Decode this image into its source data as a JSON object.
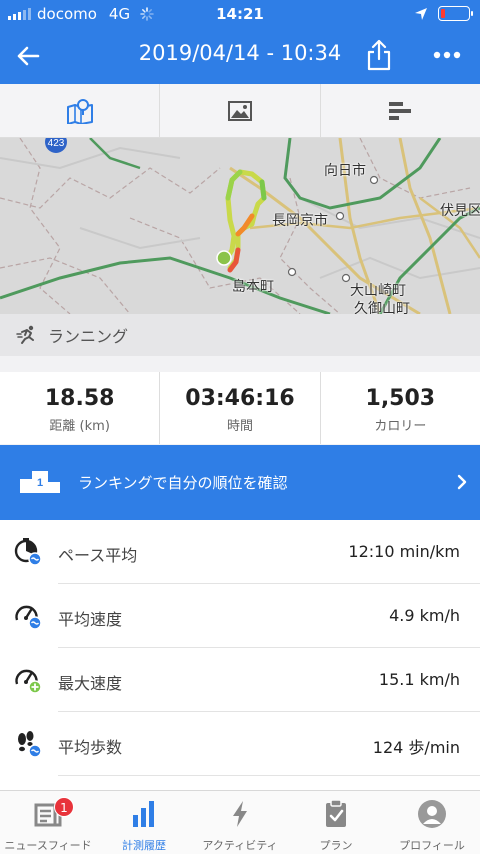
{
  "status_bar": {
    "carrier": "docomo",
    "network": "4G",
    "time": "14:21"
  },
  "header": {
    "title": "2019/04/14 - 10:34",
    "back_icon": "arrow-left-icon",
    "share_icon": "share-icon",
    "more_icon": "more-dots-icon"
  },
  "tabs": [
    {
      "icon": "map-icon",
      "active": true
    },
    {
      "icon": "image-icon",
      "active": false
    },
    {
      "icon": "bar-list-icon",
      "active": false
    }
  ],
  "map": {
    "labels": {
      "route_sign": "423",
      "mukou": "向日市",
      "nagaokakyo": "長岡京市",
      "fushimi": "伏見区",
      "shimamoto": "島本町",
      "oyamazaki": "大山崎町",
      "kuze": "久御山町"
    }
  },
  "activity": {
    "icon": "running-icon",
    "label": "ランニング"
  },
  "stats": [
    {
      "value": "18.58",
      "label": "距離 (km)"
    },
    {
      "value": "03:46:16",
      "label": "時間"
    },
    {
      "value": "1,503",
      "label": "カロリー"
    }
  ],
  "ranking": {
    "icon": "podium-icon",
    "label": "ランキングで自分の順位を確認",
    "podium_number": "1"
  },
  "details": [
    {
      "icon": "pace-icon",
      "label": "ペース平均",
      "value": "12:10 min/km"
    },
    {
      "icon": "speed-average-icon",
      "label": "平均速度",
      "value": "4.9 km/h"
    },
    {
      "icon": "speed-max-icon",
      "label": "最大速度",
      "value": "15.1 km/h"
    },
    {
      "icon": "footsteps-icon",
      "label": "平均歩数",
      "value": "124 歩/min"
    }
  ],
  "tabbar": [
    {
      "icon": "newsfeed-icon",
      "label": "ニュースフィード",
      "badge": "1",
      "active": false
    },
    {
      "icon": "history-bars-icon",
      "label": "計測履歴",
      "active": true
    },
    {
      "icon": "lightning-icon",
      "label": "アクティビティ",
      "active": false
    },
    {
      "icon": "clipboard-icon",
      "label": "プラン",
      "active": false
    },
    {
      "icon": "profile-icon",
      "label": "プロフィール",
      "active": false
    }
  ],
  "colors": {
    "brand_blue": "#2f7ee6",
    "badge_red": "#e8333b"
  }
}
